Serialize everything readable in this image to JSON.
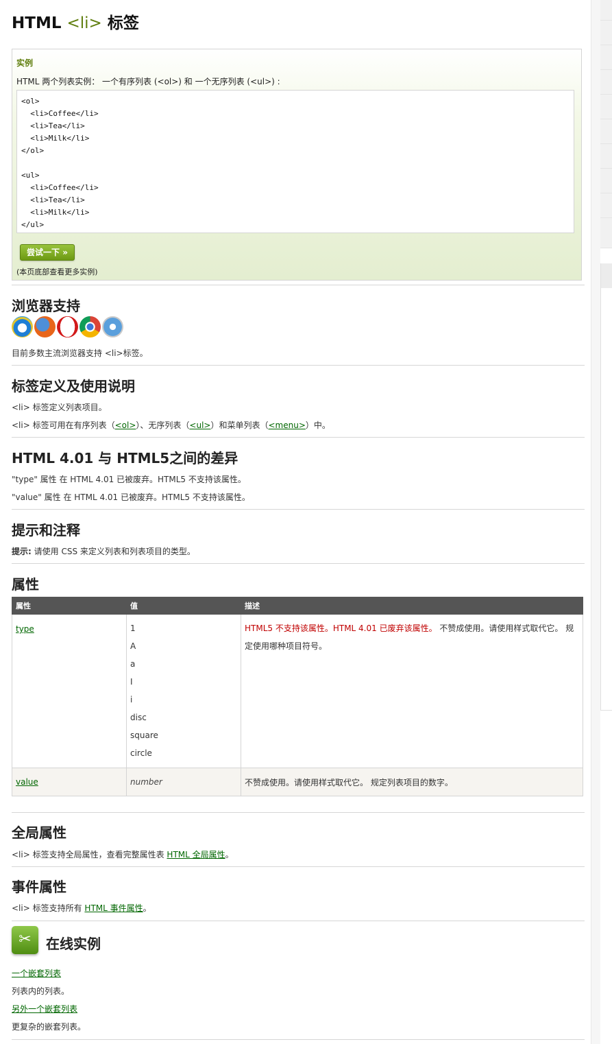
{
  "title": {
    "prefix": "HTML",
    "tag": "<li>",
    "suffix": "标签"
  },
  "example": {
    "label": "实例",
    "desc": "HTML 两个列表实例： 一个有序列表 (<ol>) 和 一个无序列表 (<ul>) :",
    "code": "<ol>\n  <li>Coffee</li>\n  <li>Tea</li>\n  <li>Milk</li>\n</ol>\n\n<ul>\n  <li>Coffee</li>\n  <li>Tea</li>\n  <li>Milk</li>\n</ul>",
    "try_button": "尝试一下 »",
    "note": "(本页底部查看更多实例)"
  },
  "browser_support": {
    "heading": "浏览器支持",
    "icons": [
      "internet-explorer-icon",
      "firefox-icon",
      "opera-icon",
      "chrome-icon",
      "safari-icon"
    ],
    "text": "目前多数主流浏览器支持 <li>标签。"
  },
  "definition": {
    "heading": "标签定义及使用说明",
    "line1": "<li> 标签定义列表项目。",
    "line2_prefix": "<li> 标签可用在有序列表（",
    "link_ol": "<ol>",
    "line2_mid1": "）、无序列表（",
    "link_ul": "<ul>",
    "line2_mid2": "）和菜单列表（",
    "link_menu": "<menu>",
    "line2_suffix": "）中。"
  },
  "differences": {
    "heading": "HTML 4.01 与 HTML5之间的差异",
    "line1": "\"type\" 属性 在 HTML 4.01 已被废弃。HTML5 不支持该属性。",
    "line2": "\"value\" 属性 在 HTML 4.01 已被废弃。HTML5 不支持该属性。"
  },
  "tips": {
    "heading": "提示和注释",
    "label": "提示:",
    "text": " 请使用 CSS 来定义列表和列表项目的类型。"
  },
  "attributes": {
    "heading": "属性",
    "columns": [
      "属性",
      "值",
      "描述"
    ],
    "rows": [
      {
        "name": "type",
        "values": [
          "1",
          "A",
          "a",
          "I",
          "i",
          "disc",
          "square",
          "circle"
        ],
        "desc_red": "HTML5 不支持该属性。HTML 4.01 已废弃该属性。",
        "desc": " 不赞成使用。请使用样式取代它。 规定使用哪种项目符号。"
      },
      {
        "name": "value",
        "value_text": "number",
        "desc": "不赞成使用。请使用样式取代它。 规定列表项目的数字。"
      }
    ]
  },
  "global_attrs": {
    "heading": "全局属性",
    "text_prefix": "<li> 标签支持全局属性，查看完整属性表 ",
    "link": "HTML 全局属性",
    "text_suffix": "。"
  },
  "event_attrs": {
    "heading": "事件属性",
    "text_prefix": "<li> 标签支持所有 ",
    "link": "HTML 事件属性",
    "text_suffix": "。"
  },
  "online_examples": {
    "heading": "在线实例",
    "items": [
      {
        "link": "一个嵌套列表",
        "desc": "列表内的列表。"
      },
      {
        "link": "另外一个嵌套列表",
        "desc": "更复杂的嵌套列表。"
      }
    ]
  }
}
